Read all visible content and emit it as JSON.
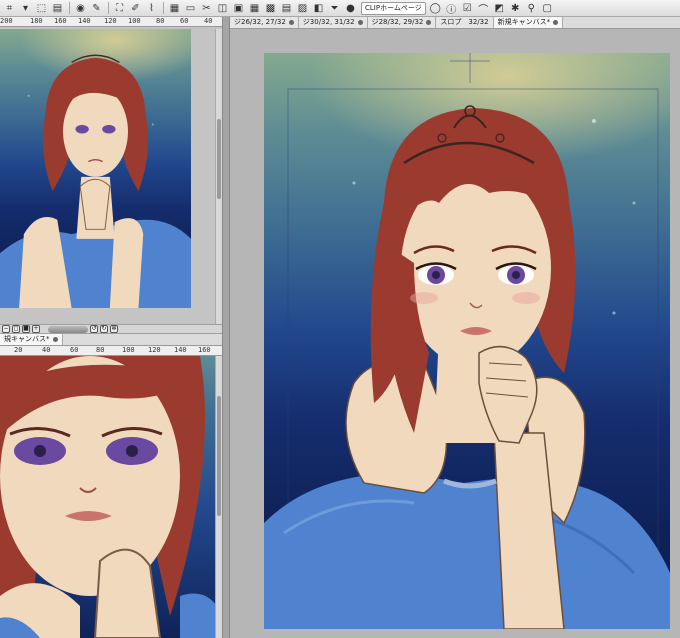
{
  "toolbar": {
    "icons": [
      "lasso-icon",
      "expand-icon",
      "selection-icon",
      "layer-icon",
      "globe-icon",
      "brush-icon",
      "transform-icon",
      "edit-icon",
      "eyedrop-icon",
      "grid-icon",
      "rect-icon",
      "scissors-icon",
      "ruler-icon",
      "frame-icon",
      "grid-icon",
      "grid-small-icon",
      "page-icon",
      "image-icon",
      "image2-icon",
      "filter-icon",
      "record-icon"
    ],
    "link_label": "CLIPホームページ"
  },
  "main_tabs": [
    {
      "label": "ジ26/32, 27/32"
    },
    {
      "label": "ジ30/32, 31/32"
    },
    {
      "label": "ジ28/32, 29/32"
    },
    {
      "label": "スロプ　32/32"
    },
    {
      "label": "新規キャンバス*"
    }
  ],
  "navigator_ruler": [
    "200",
    "180",
    "160",
    "140",
    "120",
    "100",
    "80",
    "60",
    "40"
  ],
  "subview": {
    "tab_label": "規キャンバス*",
    "ruler": [
      "20",
      "40",
      "60",
      "80",
      "100",
      "120",
      "140",
      "160"
    ]
  },
  "colors": {
    "ui_bg": "#c4c4c4",
    "toolbar": "#e8e8e8",
    "hair": "#9b3a2e",
    "skin": "#f1d9bd",
    "dress": "#4f82cf",
    "eyes": "#6a4aa0"
  }
}
